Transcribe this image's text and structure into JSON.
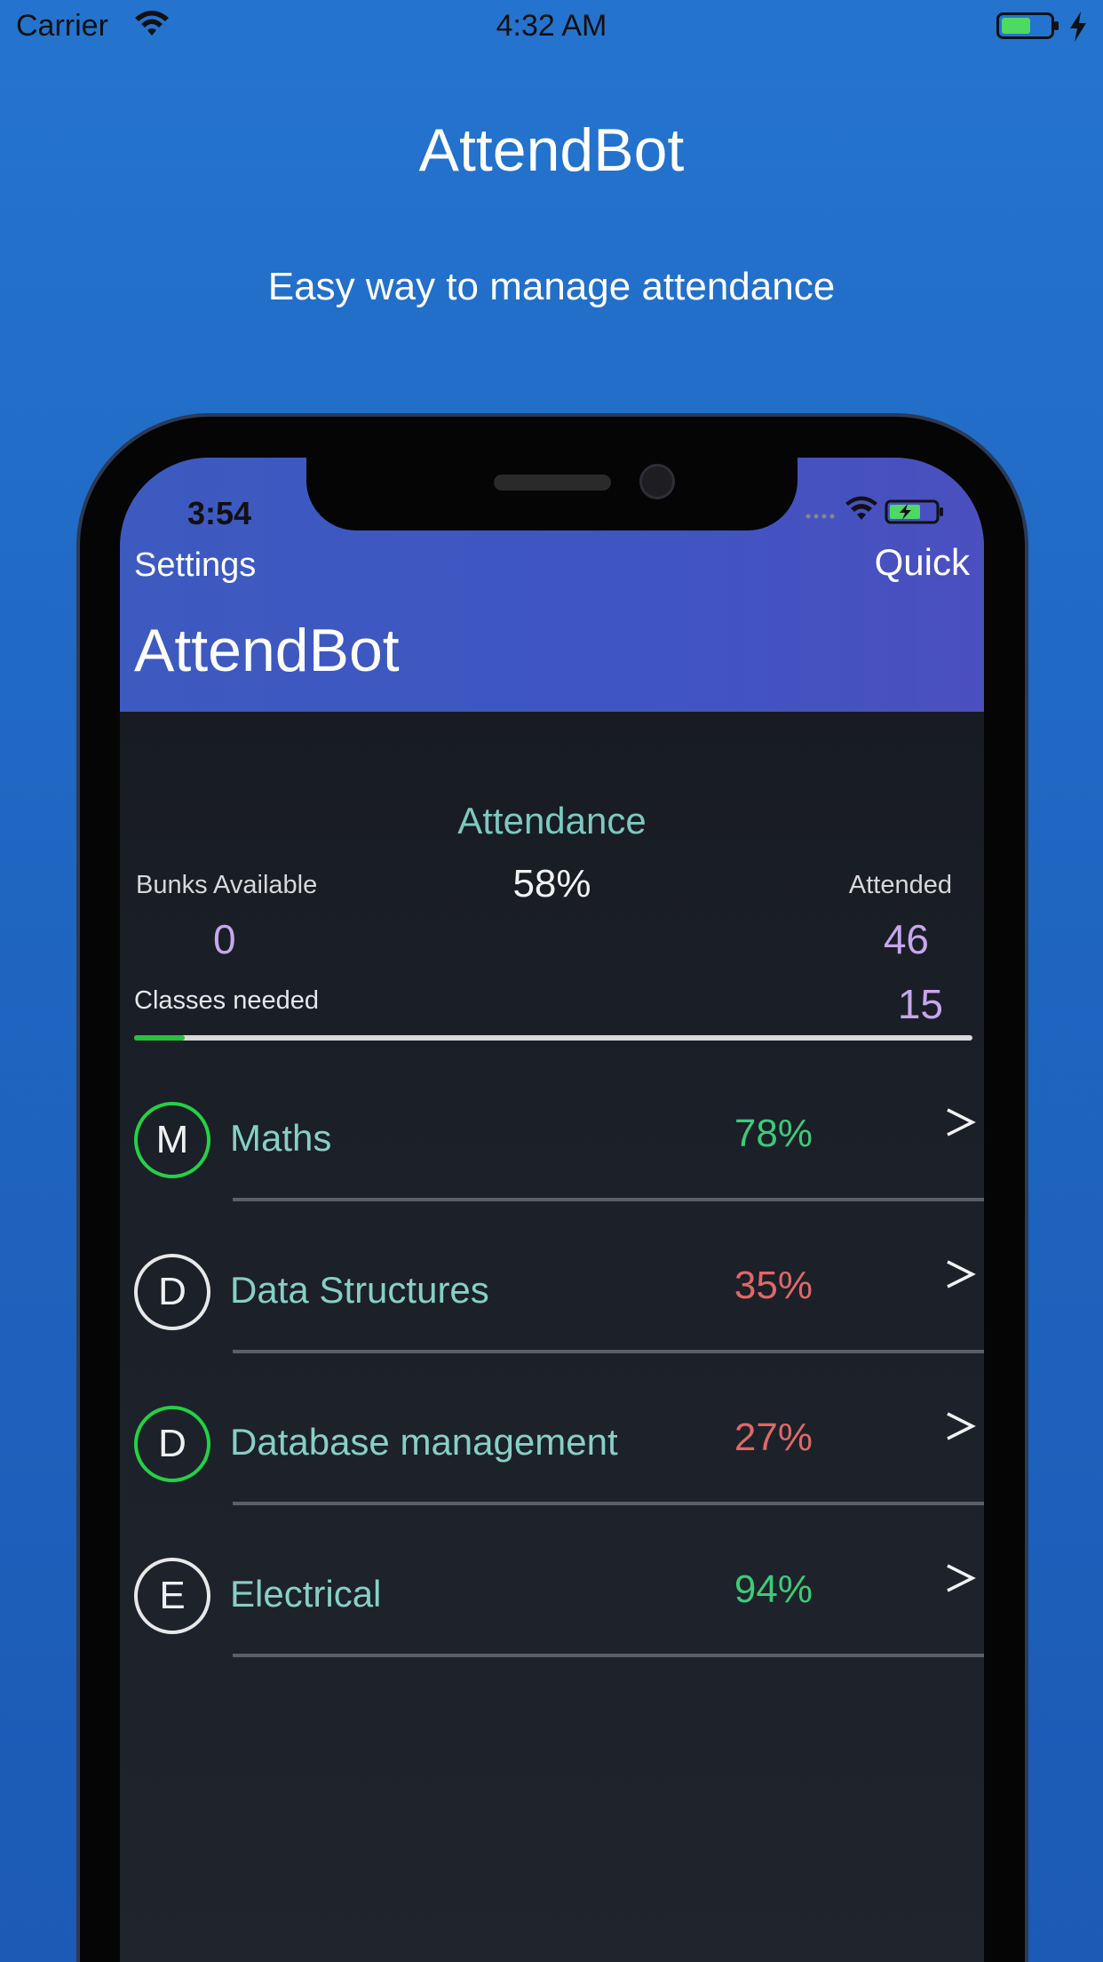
{
  "status_bar": {
    "carrier": "Carrier",
    "time": "4:32 AM"
  },
  "hero": {
    "title": "AttendBot",
    "subtitle": "Easy way to manage attendance"
  },
  "device": {
    "status_time": "3:54",
    "nav": {
      "left": "Settings",
      "right": "Quick"
    },
    "title": "AttendBot",
    "summary": {
      "heading": "Attendance",
      "percent": "58%",
      "bunks_label": "Bunks Available",
      "bunks_value": "0",
      "attended_label": "Attended",
      "attended_value": "46",
      "classes_label": "Classes needed",
      "classes_value": "15",
      "progress": 0.06
    },
    "subjects": [
      {
        "initial": "M",
        "name": "Maths",
        "percent": "78%",
        "status": "good",
        "ring": "green"
      },
      {
        "initial": "D",
        "name": "Data Structures",
        "percent": "35%",
        "status": "bad",
        "ring": "white"
      },
      {
        "initial": "D",
        "name": "Database management",
        "percent": "27%",
        "status": "bad",
        "ring": "green"
      },
      {
        "initial": "E",
        "name": "Electrical",
        "percent": "94%",
        "status": "good",
        "ring": "white"
      }
    ]
  },
  "colors": {
    "background": "#2474cf",
    "header": "#3f55c2",
    "good": "#3ccb78",
    "bad": "#df6868",
    "accent_teal": "#7cc9c0",
    "value_purple": "#c7a6ee",
    "progress_green": "#25c23c"
  },
  "icons": [
    "wifi-icon",
    "battery-icon",
    "charging-bolt-icon",
    "chevron-right-icon"
  ]
}
